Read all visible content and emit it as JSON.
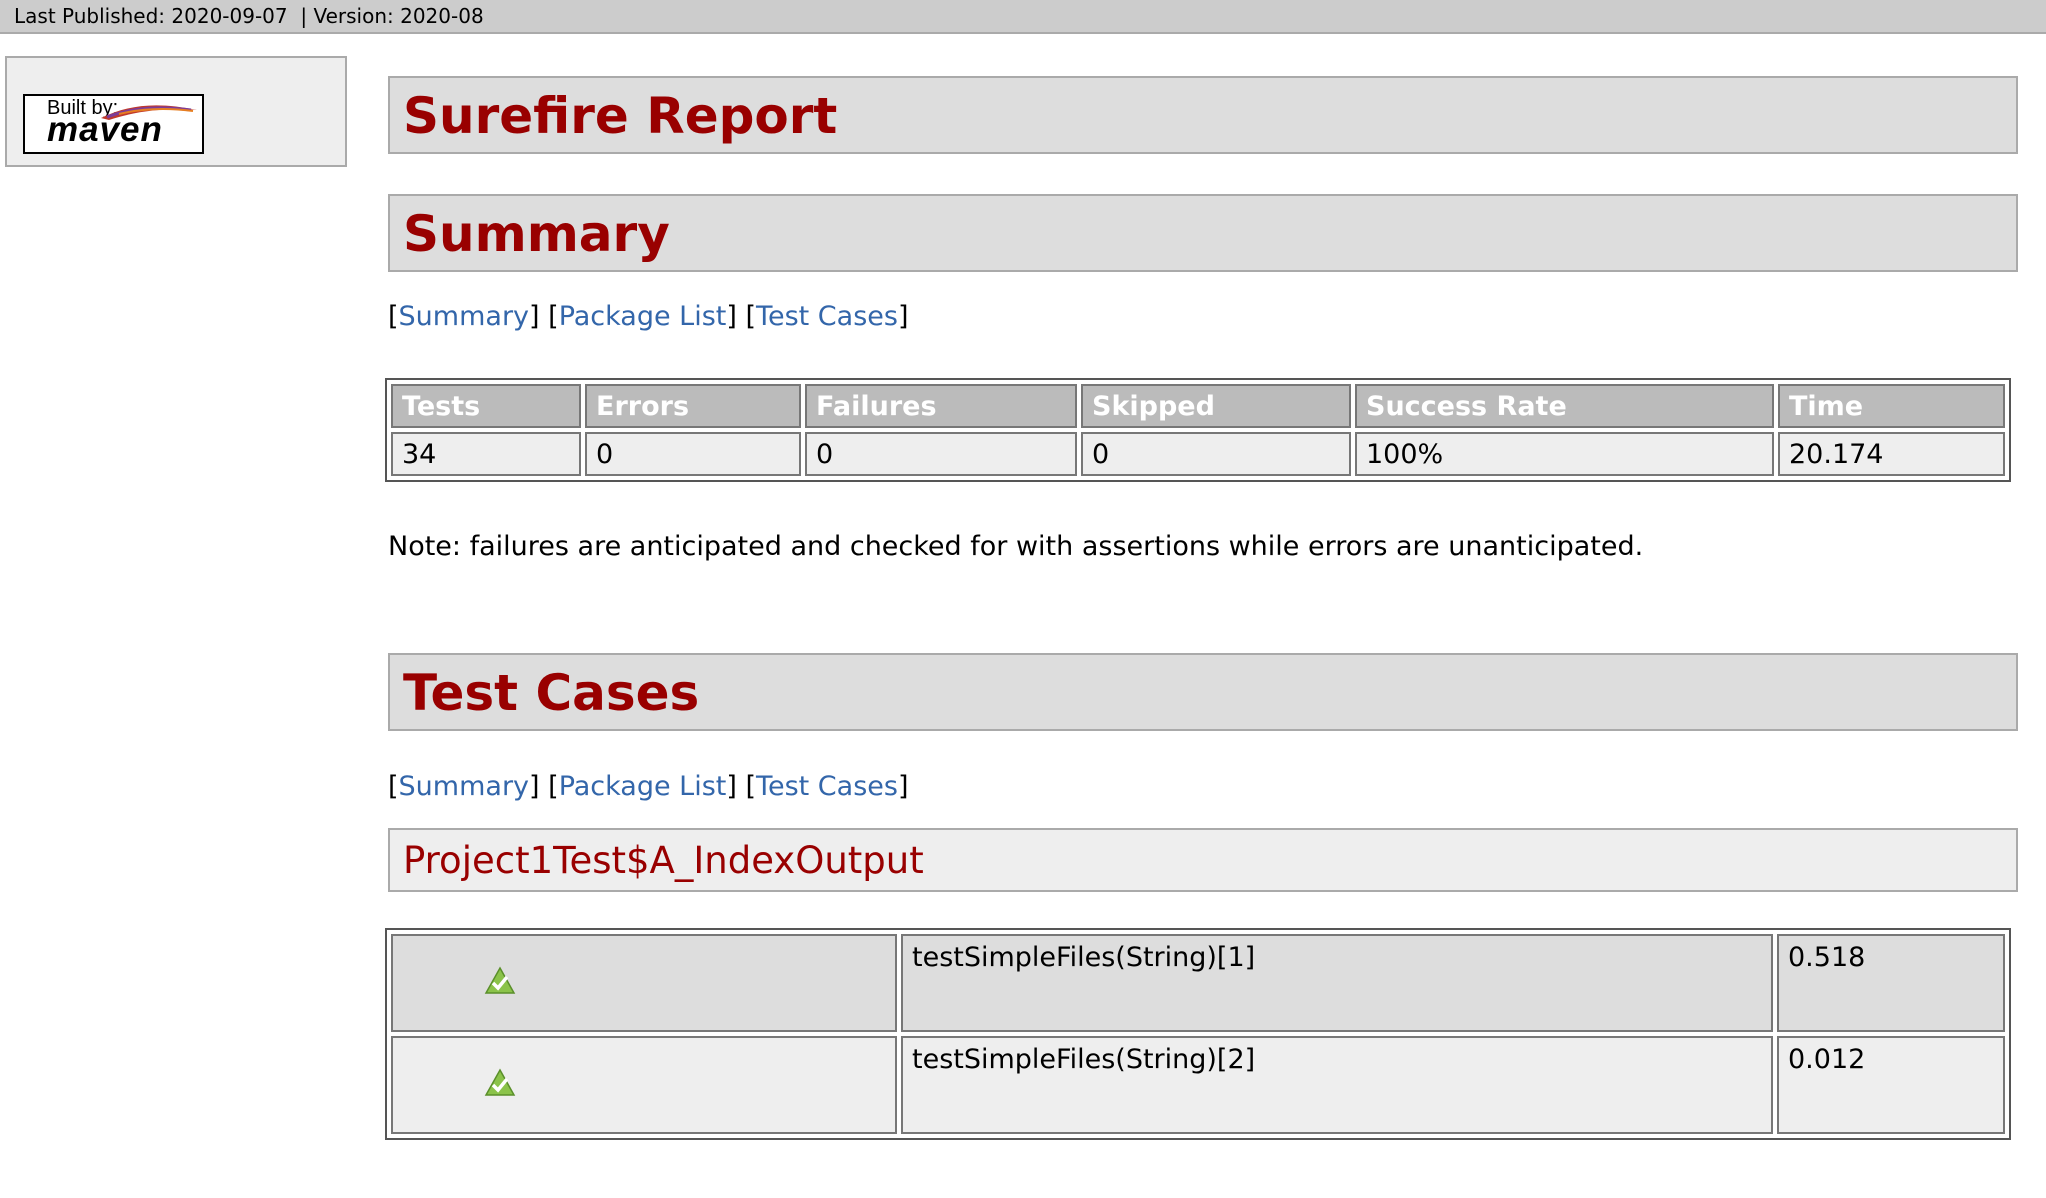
{
  "topbar": {
    "last_published": "Last Published: 2020-09-07",
    "separator": "|",
    "version": "Version: 2020-08"
  },
  "sidebar": {
    "badge_built_by": "Built by:",
    "badge_name": "maven"
  },
  "report": {
    "title": "Surefire Report"
  },
  "summary": {
    "title": "Summary",
    "nav": {
      "summary": "Summary",
      "package_list": "Package List",
      "test_cases": "Test Cases"
    },
    "columns": [
      "Tests",
      "Errors",
      "Failures",
      "Skipped",
      "Success Rate",
      "Time"
    ],
    "values": [
      "34",
      "0",
      "0",
      "0",
      "100%",
      "20.174"
    ],
    "note": "Note: failures are anticipated and checked for with assertions while errors are unanticipated."
  },
  "test_cases": {
    "title": "Test Cases",
    "nav": {
      "summary": "Summary",
      "package_list": "Package List",
      "test_cases": "Test Cases"
    },
    "class_name": "Project1Test$A_IndexOutput",
    "rows": [
      {
        "name": "testSimpleFiles(String)[1]",
        "time": "0.518",
        "status_icon": "success-check-icon"
      },
      {
        "name": "testSimpleFiles(String)[2]",
        "time": "0.012",
        "status_icon": "success-check-icon"
      }
    ]
  },
  "colors": {
    "header_red": "#990000",
    "link_blue": "#3366aa",
    "table_header_gray": "#bbbbbb"
  }
}
